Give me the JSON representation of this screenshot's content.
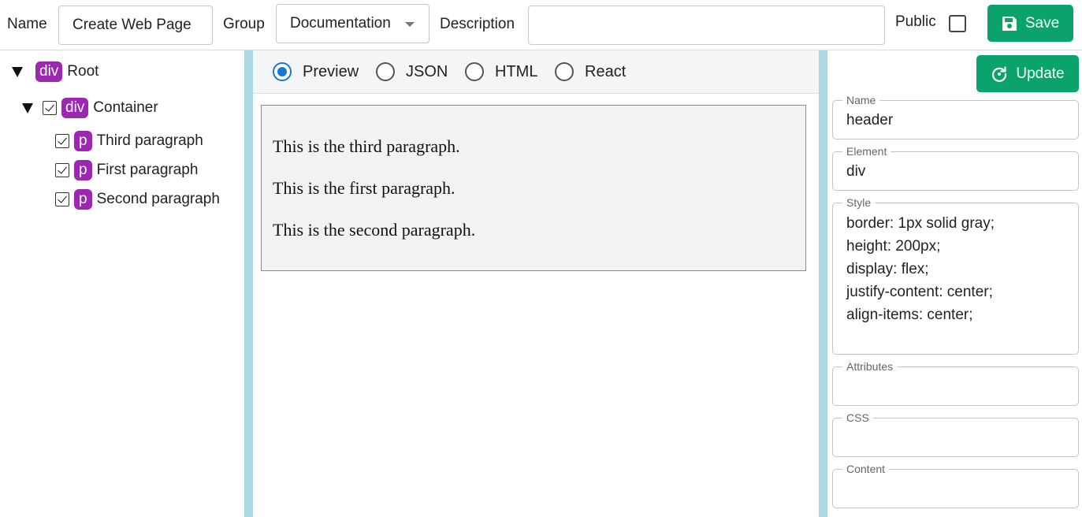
{
  "toolbar": {
    "name_label": "Name",
    "name_value": "Create Web Page",
    "group_label": "Group",
    "group_value": "Documentation",
    "description_label": "Description",
    "description_value": "",
    "public_label": "Public",
    "public_checked": false,
    "save_label": "Save",
    "accent_color": "#0aa36c"
  },
  "tree": {
    "root": {
      "tag": "div",
      "label": "Root",
      "expanded": true
    },
    "container": {
      "tag": "div",
      "label": "Container",
      "expanded": true,
      "checked": true
    },
    "children": [
      {
        "tag": "p",
        "label": "Third paragraph",
        "checked": true
      },
      {
        "tag": "p",
        "label": "First paragraph",
        "checked": true
      },
      {
        "tag": "p",
        "label": "Second paragraph",
        "checked": true
      }
    ],
    "tag_color": "#9c27b0"
  },
  "view": {
    "options": [
      "Preview",
      "JSON",
      "HTML",
      "React"
    ],
    "selected": "Preview"
  },
  "preview": {
    "paragraphs": [
      "This is the third paragraph.",
      "This is the first paragraph.",
      "This is the second paragraph."
    ]
  },
  "properties": {
    "update_label": "Update",
    "name_label": "Name",
    "name_value": "header",
    "element_label": "Element",
    "element_value": "div",
    "style_label": "Style",
    "style_lines": [
      "border: 1px solid gray;",
      "height: 200px;",
      "display: flex;",
      "justify-content: center;",
      "align-items: center;"
    ],
    "attributes_label": "Attributes",
    "attributes_value": "",
    "css_label": "CSS",
    "css_value": "",
    "content_label": "Content",
    "content_value": ""
  }
}
